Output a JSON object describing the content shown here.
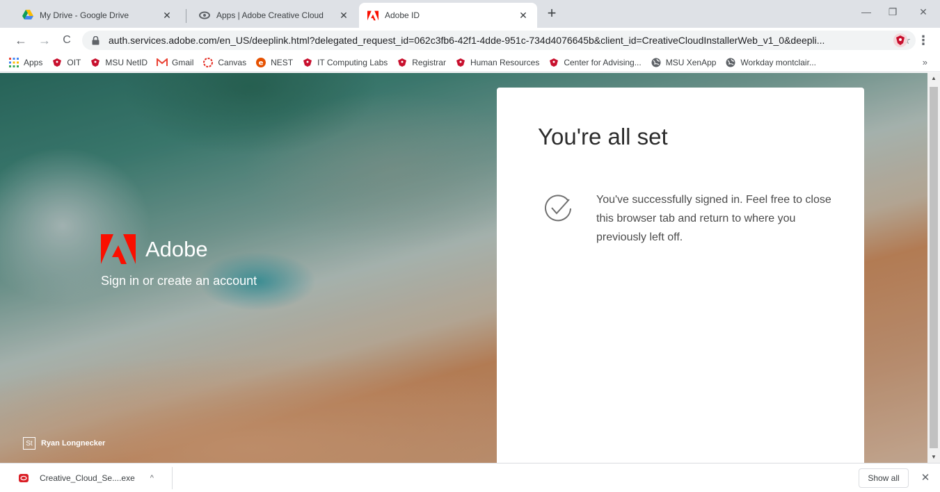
{
  "tabs": [
    {
      "title": "My Drive - Google Drive",
      "icon": "google-drive-icon",
      "close": "✕",
      "active": false
    },
    {
      "title": "Apps | Adobe Creative Cloud",
      "icon": "creative-cloud-icon",
      "close": "✕",
      "active": false
    },
    {
      "title": "Adobe ID",
      "icon": "adobe-icon",
      "close": "✕",
      "active": true
    }
  ],
  "new_tab_label": "+",
  "window_controls": {
    "minimize": "—",
    "restore": "❐",
    "close": "✕"
  },
  "toolbar": {
    "back": "←",
    "forward": "→",
    "reload": "C",
    "url": "auth.services.adobe.com/en_US/deeplink.html?delegated_request_id=062c3fb6-42f1-4dde-951c-734d4076645b&client_id=CreativeCloudInstallerWeb_v1_0&deepli...",
    "star": "☆",
    "menu": "⋮"
  },
  "bookmarks": [
    {
      "label": "Apps",
      "icon": "apps-grid-icon"
    },
    {
      "label": "OIT",
      "icon": "msu-red-hawk-icon"
    },
    {
      "label": "MSU NetID",
      "icon": "msu-red-hawk-icon"
    },
    {
      "label": "Gmail",
      "icon": "gmail-icon"
    },
    {
      "label": "Canvas",
      "icon": "canvas-icon"
    },
    {
      "label": "NEST",
      "icon": "nest-icon"
    },
    {
      "label": "IT Computing Labs",
      "icon": "msu-red-hawk-icon"
    },
    {
      "label": "Registrar",
      "icon": "msu-red-hawk-icon"
    },
    {
      "label": "Human Resources",
      "icon": "msu-red-hawk-icon"
    },
    {
      "label": "Center for Advising...",
      "icon": "msu-red-hawk-icon"
    },
    {
      "label": "MSU XenApp",
      "icon": "globe-icon"
    },
    {
      "label": "Workday montclair...",
      "icon": "globe-icon"
    }
  ],
  "bookmarks_more": "»",
  "brand": {
    "name": "Adobe",
    "tagline": "Sign in or create an account"
  },
  "photo_credit": {
    "badge": "St",
    "author": "Ryan Longnecker"
  },
  "card": {
    "title": "You're all set",
    "message": "You've successfully signed in. Feel free to close this browser tab and return to where you previously left off."
  },
  "scrollbar": {
    "up": "▲",
    "down": "▼"
  },
  "download_shelf": {
    "file_name": "Creative_Cloud_Se....exe",
    "caret": "^",
    "show_all": "Show all",
    "close": "✕"
  },
  "colors": {
    "adobe_red": "#fa0f00",
    "tab_strip": "#dee1e6",
    "card_bg": "#ffffff",
    "msu_red": "#c8102e"
  }
}
